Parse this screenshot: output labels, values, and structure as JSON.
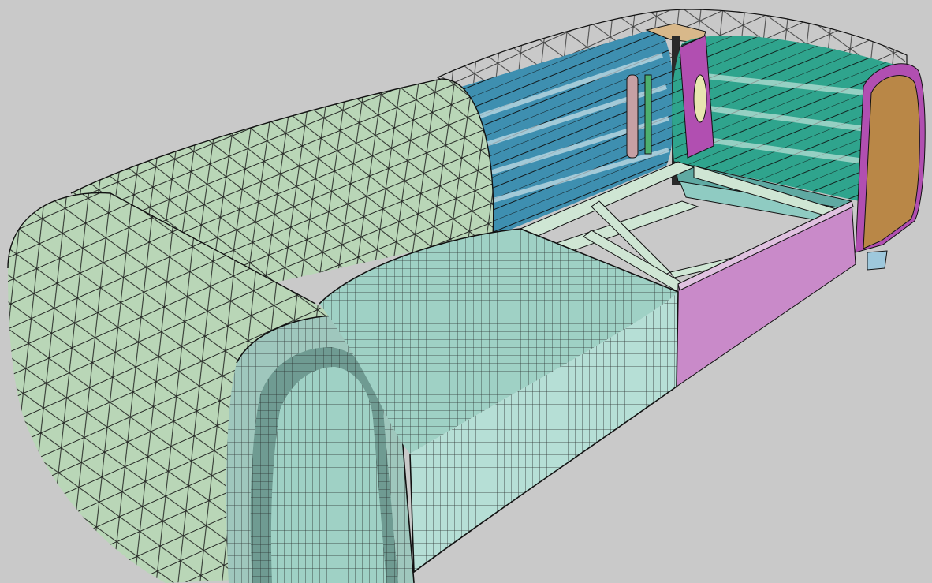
{
  "viewport": {
    "background": "#c9c9c9",
    "wire": "#111111"
  },
  "model": {
    "colors": {
      "sage_fabric": "#b9d6b7",
      "sage_fabric_shade": "#a9c6a6",
      "arm_inner": "#9fc7bd",
      "arm_inner_shade": "#6f9b92",
      "cushion": "#9fd1c5",
      "cushion_front": "#b6dfd6",
      "frame_rails": "#cfe6d4",
      "inner_panel": "#6fb6b0",
      "blue_slats": "#3e8fb0",
      "teal_slats": "#2fa48d",
      "magenta_panel": "#c98ac9",
      "magenta_dark": "#b14fb1",
      "wood_end": "#b98747",
      "wood_top": "#d8b88a",
      "cylinder": "#9ec8dc"
    }
  }
}
